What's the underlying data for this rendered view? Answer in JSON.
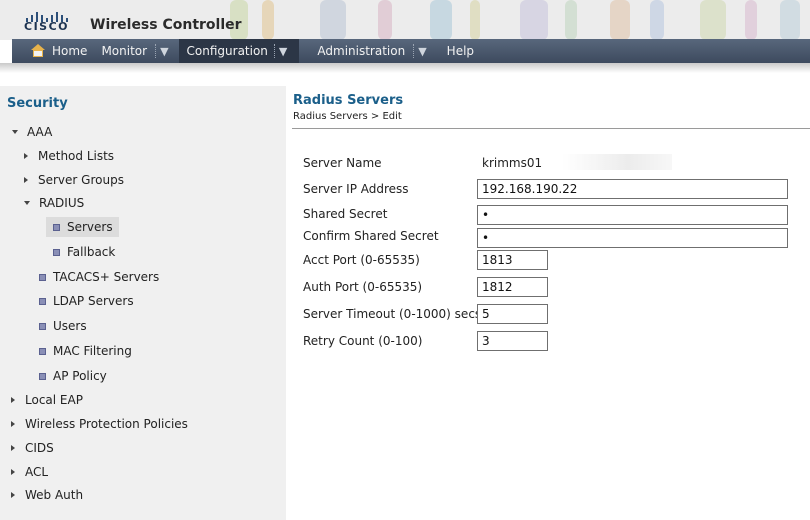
{
  "header": {
    "logo_text": "CISCO",
    "app_title": "Wireless Controller"
  },
  "nav": {
    "items": [
      {
        "label": "Home",
        "icon": "home-icon"
      },
      {
        "label": "Monitor",
        "dropdown": "▼"
      },
      {
        "label": "Configuration",
        "dropdown": "▼",
        "active": true
      },
      {
        "label": "Administration",
        "dropdown": "▼"
      },
      {
        "label": "Help"
      }
    ]
  },
  "sidebar": {
    "title": "Security",
    "tree": [
      {
        "label": "AAA",
        "expanded": true
      },
      {
        "label": "Method Lists"
      },
      {
        "label": "Server Groups"
      },
      {
        "label": "RADIUS",
        "expanded": true
      },
      {
        "label": "Servers",
        "selected": true
      },
      {
        "label": "Fallback"
      },
      {
        "label": "TACACS+ Servers"
      },
      {
        "label": "LDAP Servers"
      },
      {
        "label": "Users"
      },
      {
        "label": "MAC Filtering"
      },
      {
        "label": "AP Policy"
      },
      {
        "label": "Local EAP"
      },
      {
        "label": "Wireless Protection Policies"
      },
      {
        "label": "CIDS"
      },
      {
        "label": "ACL"
      },
      {
        "label": "Web Auth"
      }
    ]
  },
  "main": {
    "title": "Radius Servers",
    "breadcrumb": "Radius Servers > Edit",
    "form": {
      "server_name": {
        "label": "Server Name",
        "value": "krimms01"
      },
      "server_ip": {
        "label": "Server IP Address",
        "value": "192.168.190.22"
      },
      "shared_secret": {
        "label": "Shared Secret",
        "value": "•"
      },
      "confirm_secret": {
        "label": "Confirm Shared Secret",
        "value": "•"
      },
      "acct_port": {
        "label": "Acct Port (0-65535)",
        "value": "1813"
      },
      "auth_port": {
        "label": "Auth Port (0-65535)",
        "value": "1812"
      },
      "timeout": {
        "label": "Server Timeout (0-1000) secs",
        "value": "5"
      },
      "retry": {
        "label": "Retry Count (0-100)",
        "value": "3"
      }
    }
  },
  "colors": {
    "accent": "#1b5f8a",
    "nav_bg": "#4a576b",
    "nav_active": "#2c3646",
    "sidebar_bg": "#f0f0f0"
  }
}
